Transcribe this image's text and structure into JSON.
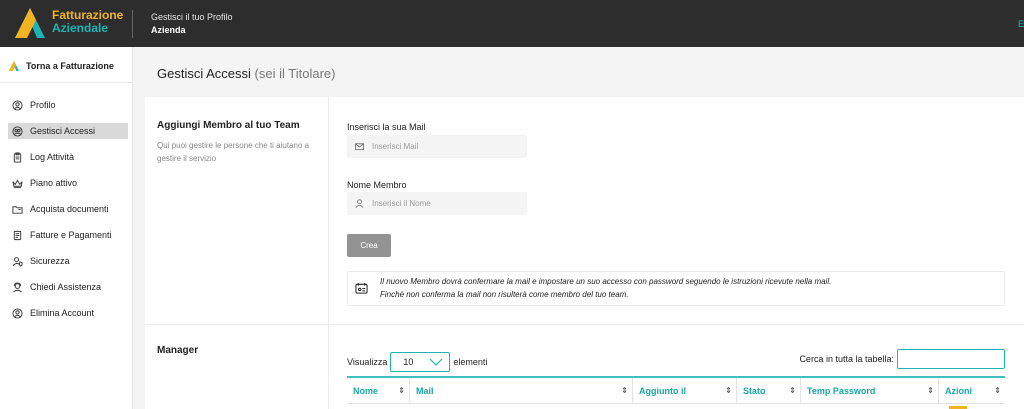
{
  "header": {
    "brand_line1": "Fatturazione",
    "brand_line2": "Aziendale",
    "breadcrumb_top": "Gestisci il tuo Profilo",
    "breadcrumb_bottom": "Azienda",
    "edge_text": "E"
  },
  "sidebar": {
    "back_label": "Torna a Fatturazione",
    "items": [
      {
        "label": "Profilo",
        "icon": "user-circle-icon"
      },
      {
        "label": "Gestisci Accessi",
        "icon": "team-icon",
        "active": true
      },
      {
        "label": "Log Attività",
        "icon": "clipboard-icon"
      },
      {
        "label": "Piano attivo",
        "icon": "crown-icon"
      },
      {
        "label": "Acquista documenti",
        "icon": "folder-icon"
      },
      {
        "label": "Fatture e Pagamenti",
        "icon": "receipt-icon"
      },
      {
        "label": "Sicurezza",
        "icon": "shield-user-icon"
      },
      {
        "label": "Chiedi Assistenza",
        "icon": "support-icon"
      },
      {
        "label": "Elimina Account",
        "icon": "remove-user-icon"
      }
    ]
  },
  "main": {
    "title": "Gestisci Accessi",
    "title_suffix": "(sei il Titolare)",
    "add_member": {
      "title": "Aggiungi Membro al tuo Team",
      "description": "Qui puoi gestire le persone che ti aiutano a gestire il servizio",
      "email_label": "Inserisci la sua Mail",
      "email_placeholder": "Inserisci Mail",
      "name_label": "Nome Membro",
      "name_placeholder": "Inserisci il Nome",
      "submit_label": "Crea",
      "notice_line1": "Il nuovo Membro dovrà confermare la mail e impostare un suo accesso con password seguendo le istruzioni ricevute nella mail.",
      "notice_line2": "Finchè non conferma la mail non risulterà come membro del tuo team."
    },
    "manager": {
      "title": "Manager",
      "show_label": "Visualizza",
      "page_size": "10",
      "entries_label": "elementi",
      "search_label": "Cerca in tutta la tabella:",
      "search_value": "",
      "columns": [
        "Nome",
        "Mail",
        "Aggiunto il",
        "Stato",
        "Temp Password",
        "Azioni"
      ]
    }
  },
  "colors": {
    "accent_teal": "#1fb3b3",
    "accent_yellow": "#f0b323",
    "header_bg": "#2d2d2d"
  }
}
